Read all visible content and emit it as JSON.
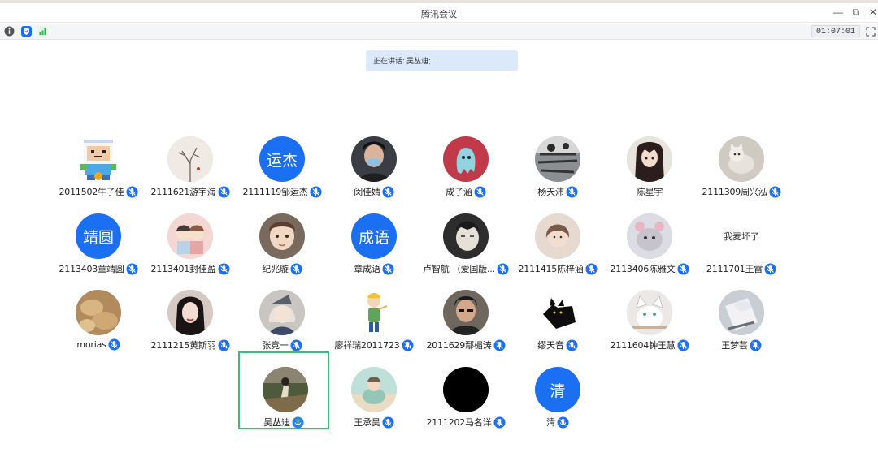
{
  "window": {
    "title": "腾讯会议",
    "controls": [
      {
        "name": "minimize-button",
        "glyph": "—"
      },
      {
        "name": "restore-button",
        "glyph": "⧉"
      },
      {
        "name": "close-button",
        "glyph": "✕"
      }
    ]
  },
  "toolbar": {
    "icons": [
      "info-icon",
      "shield-icon",
      "signal-icon"
    ],
    "timer": "01:07:01",
    "fullscreen_icon": "fullscreen-icon"
  },
  "speaking": {
    "label": "正在讲话: 吴丛迪;"
  },
  "colors": {
    "accent": "#1a6ff2",
    "active_border": "#3dbd73",
    "speaking_bg": "#dce9fb"
  },
  "participants": [
    [
      {
        "name": "2011502牛子佳",
        "avatar": "pixel-adventure-character",
        "mic": "muted-mic-icon"
      },
      {
        "name": "2111621游宇海",
        "avatar": "branches-photo",
        "mic": "muted-mic-icon"
      },
      {
        "name": "2111119邹运杰",
        "avatar": "text",
        "avatar_text": "运杰",
        "mic": "muted-mic-icon"
      },
      {
        "name": "闵佳婧",
        "avatar": "portrait-photo",
        "mic": "muted-mic-icon"
      },
      {
        "name": "成子涵",
        "avatar": "ghost-illustration",
        "mic": "muted-mic-icon"
      },
      {
        "name": "杨天沛",
        "avatar": "ink-drawing",
        "mic": "muted-mic-icon"
      },
      {
        "name": "陈星宇",
        "avatar": "anime-girl",
        "mic": ""
      },
      {
        "name": "2111309周兴泓",
        "avatar": "kitten-photo",
        "mic": "muted-mic-icon"
      }
    ],
    [
      {
        "name": "2113403童靖圆",
        "avatar": "text",
        "avatar_text": "靖圆",
        "mic": "muted-mic-icon"
      },
      {
        "name": "2113401封佳盈",
        "avatar": "cartoon-couple",
        "mic": "muted-mic-icon"
      },
      {
        "name": "纪兆璇",
        "avatar": "child-photo",
        "mic": "muted-mic-icon"
      },
      {
        "name": "章成语",
        "avatar": "text",
        "avatar_text": "成语",
        "mic": "muted-mic-icon"
      },
      {
        "name": "卢智航 （爱国版...",
        "avatar": "sketch-face",
        "mic": "muted-mic-icon"
      },
      {
        "name": "2111415陈梓涵",
        "avatar": "girl-photo",
        "mic": "muted-mic-icon"
      },
      {
        "name": "2113406陈雅文",
        "avatar": "plush-toy",
        "mic": "muted-mic-icon"
      },
      {
        "name": "2111701王雷",
        "avatar": "none",
        "avatar_text": "我麦坏了",
        "mic": "muted-mic-icon"
      }
    ],
    [
      {
        "name": "morias",
        "avatar": "bread-photo",
        "mic": "muted-mic-icon"
      },
      {
        "name": "2111215黄斯羽",
        "avatar": "woman-photo",
        "mic": "muted-mic-icon"
      },
      {
        "name": "张竞一",
        "avatar": "anime-character",
        "mic": "muted-mic-icon"
      },
      {
        "name": "廖祥瑞2011723",
        "avatar": "little-prince",
        "mic": "muted-mic-icon"
      },
      {
        "name": "2011629鄢楣涛",
        "avatar": "man-photo",
        "mic": "muted-mic-icon"
      },
      {
        "name": "缪天音",
        "avatar": "black-cat",
        "mic": "muted-mic-icon"
      },
      {
        "name": "2111604钟王慧",
        "avatar": "cat-illustration",
        "mic": "muted-mic-icon"
      },
      {
        "name": "王梦芸",
        "avatar": "paper-photo",
        "mic": "muted-mic-icon"
      }
    ],
    [
      {
        "name": "吴丛迪",
        "avatar": "outdoor-photo",
        "mic": "speaking-mic-icon",
        "active": true
      },
      {
        "name": "王承昊",
        "avatar": "beach-illustration",
        "mic": "muted-mic-icon"
      },
      {
        "name": "2111202马名洋",
        "avatar": "black-circle",
        "mic": "muted-mic-icon"
      },
      {
        "name": "清",
        "avatar": "text",
        "avatar_text": "清",
        "mic": "muted-mic-icon"
      }
    ]
  ]
}
